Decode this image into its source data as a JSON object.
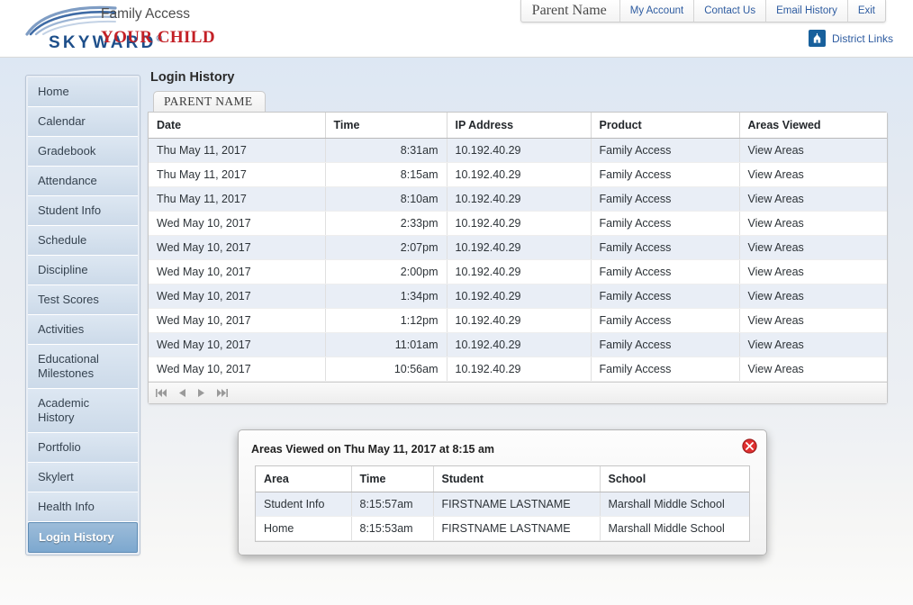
{
  "header": {
    "brand_word": "SKYWARD",
    "brand_reg": "®",
    "product_title": "Family Access",
    "subtitle": "YOUR CHILD",
    "user_name": "Parent Name",
    "nav_links": [
      {
        "label": "My Account"
      },
      {
        "label": "Contact Us"
      },
      {
        "label": "Email History"
      },
      {
        "label": "Exit"
      }
    ],
    "district_links_label": "District Links",
    "district_icon": "school-building-icon",
    "brand_blue": "#1e4f8a",
    "accent_red": "#c32026",
    "link_blue": "#2d5ba0"
  },
  "sidebar": {
    "items": [
      {
        "label": "Home",
        "selected": false
      },
      {
        "label": "Calendar",
        "selected": false
      },
      {
        "label": "Gradebook",
        "selected": false
      },
      {
        "label": "Attendance",
        "selected": false
      },
      {
        "label": "Student Info",
        "selected": false
      },
      {
        "label": "Schedule",
        "selected": false
      },
      {
        "label": "Discipline",
        "selected": false
      },
      {
        "label": "Test Scores",
        "selected": false
      },
      {
        "label": "Activities",
        "selected": false
      },
      {
        "label": "Educational Milestones",
        "selected": false
      },
      {
        "label": "Academic History",
        "selected": false
      },
      {
        "label": "Portfolio",
        "selected": false
      },
      {
        "label": "Skylert",
        "selected": false
      },
      {
        "label": "Health Info",
        "selected": false
      },
      {
        "label": "Login History",
        "selected": true
      }
    ]
  },
  "main": {
    "page_title": "Login History",
    "tab_label": "PARENT NAME",
    "table": {
      "columns": [
        "Date",
        "Time",
        "IP Address",
        "Product",
        "Areas Viewed"
      ],
      "rows": [
        {
          "date": "Thu May 11, 2017",
          "time": "8:31am",
          "ip": "10.192.40.29",
          "product": "Family Access",
          "areas": "View Areas"
        },
        {
          "date": "Thu May 11, 2017",
          "time": "8:15am",
          "ip": "10.192.40.29",
          "product": "Family Access",
          "areas": "View Areas"
        },
        {
          "date": "Thu May 11, 2017",
          "time": "8:10am",
          "ip": "10.192.40.29",
          "product": "Family Access",
          "areas": "View Areas"
        },
        {
          "date": "Wed May 10, 2017",
          "time": "2:33pm",
          "ip": "10.192.40.29",
          "product": "Family Access",
          "areas": "View Areas"
        },
        {
          "date": "Wed May 10, 2017",
          "time": "2:07pm",
          "ip": "10.192.40.29",
          "product": "Family Access",
          "areas": "View Areas"
        },
        {
          "date": "Wed May 10, 2017",
          "time": "2:00pm",
          "ip": "10.192.40.29",
          "product": "Family Access",
          "areas": "View Areas"
        },
        {
          "date": "Wed May 10, 2017",
          "time": "1:34pm",
          "ip": "10.192.40.29",
          "product": "Family Access",
          "areas": "View Areas"
        },
        {
          "date": "Wed May 10, 2017",
          "time": "1:12pm",
          "ip": "10.192.40.29",
          "product": "Family Access",
          "areas": "View Areas"
        },
        {
          "date": "Wed May 10, 2017",
          "time": "11:01am",
          "ip": "10.192.40.29",
          "product": "Family Access",
          "areas": "View Areas"
        },
        {
          "date": "Wed May 10, 2017",
          "time": "10:56am",
          "ip": "10.192.40.29",
          "product": "Family Access",
          "areas": "View Areas"
        }
      ]
    },
    "pager": {
      "first_icon": "first-page-icon",
      "prev_icon": "previous-page-icon",
      "next_icon": "next-page-icon",
      "last_icon": "last-page-icon"
    }
  },
  "modal": {
    "title": "Areas Viewed on Thu May 11, 2017 at 8:15 am",
    "close_icon": "close-icon",
    "table": {
      "columns": [
        "Area",
        "Time",
        "Student",
        "School"
      ],
      "rows": [
        {
          "area": "Student Info",
          "time": "8:15:57am",
          "student": "FIRSTNAME LASTNAME",
          "school": "Marshall Middle School"
        },
        {
          "area": "Home",
          "time": "8:15:53am",
          "student": "FIRSTNAME LASTNAME",
          "school": "Marshall Middle School"
        }
      ]
    }
  }
}
